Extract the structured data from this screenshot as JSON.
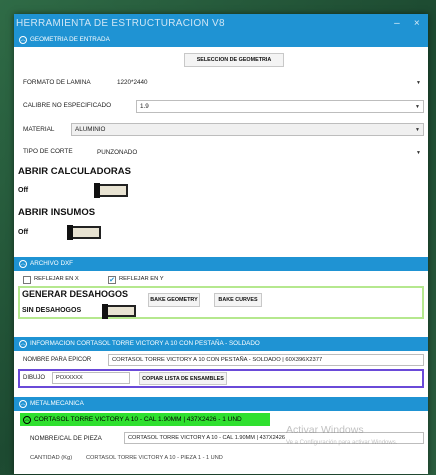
{
  "window": {
    "title": "HERRAMIENTA DE ESTRUCTURACION V8",
    "minimize": "–",
    "close": "×"
  },
  "geometria": {
    "header": "GEOMETRIA DE ENTRADA",
    "select_button": "SELECCION DE GEOMETRIA",
    "formato_label": "FORMATO DE LAMINA",
    "formato_value": "1220*2440",
    "calibre_label": "CALIBRE NO ESPECIFICADO",
    "calibre_value": "1.9",
    "material_label": "MATERIAL",
    "material_value": "ALUMINIO",
    "tipo_corte_label": "TIPO DE CORTE",
    "tipo_corte_value": "PUNZONADO",
    "abrir_calculadoras": "ABRIR CALCULADORAS",
    "calc_state": "Off",
    "abrir_insumos": "ABRIR INSUMOS",
    "insumos_state": "Off"
  },
  "archivo_dxf": {
    "header": "ARCHIVO DXF",
    "reflejar_x": "REFLEJAR EN X",
    "reflejar_x_checked": false,
    "reflejar_y": "REFLEJAR EN Y",
    "reflejar_y_checked": true,
    "generar_desahogos": "GENERAR DESAHOGOS",
    "sin_desahogos": "SIN DESAHOGOS",
    "bake_geometry": "BAKE GEOMETRY",
    "bake_curves": "BAKE CURVES"
  },
  "informacion": {
    "header": "INFORMACION CORTASOL TORRE VICTORY A 10 CON PESTAÑA - SOLDADO",
    "nombre_epicor_label": "NOMBRE PARA EPICOR",
    "nombre_epicor_value": "CORTASOL TORRE VICTORY A 10 CON PESTAÑA - SOLDADO | 60X396X2377",
    "dibujo_label": "DIBUJO",
    "dibujo_value": "POXXXXX",
    "copiar_button": "COPIAR LISTA DE ENSAMBLES"
  },
  "metalmecanica": {
    "header": "METALMECANICA",
    "item": "CORTASOL TORRE VICTORY A 10 - CAL 1.90MM | 437X2426 - 1 UND",
    "nombre_label": "NOMBRE/CAL DE PIEZA",
    "nombre_value": "CORTASOL TORRE VICTORY A 10 - CAL 1.90MM | 437X2426",
    "cantidad_label": "CANTIDAD (Kg)",
    "cantidad_value": "CORTASOL TORRE VICTORY A 10 - PIEZA 1 - 1 UND"
  },
  "watermark": {
    "line1": "Activar Windows",
    "line2": "Ve a Configuración para activar Windows."
  }
}
